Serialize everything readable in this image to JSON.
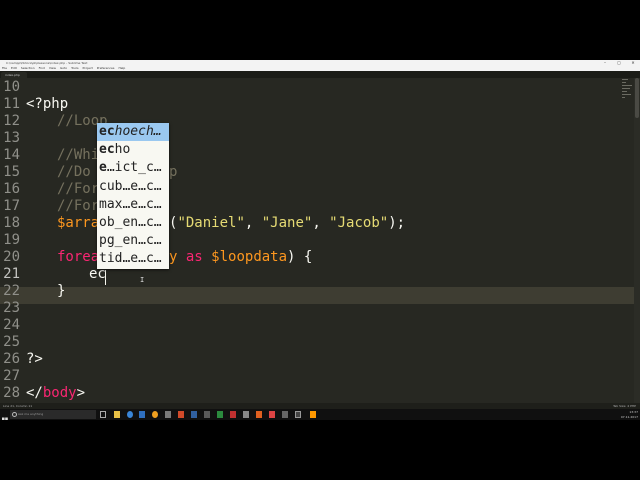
{
  "window": {
    "title": "C:\\xampp\\htdocs\\phplessons\\index.php - Sublime Text",
    "controls": [
      "–",
      "▢",
      "✕"
    ]
  },
  "menu": [
    "File",
    "Edit",
    "Selection",
    "Find",
    "View",
    "Goto",
    "Tools",
    "Project",
    "Preferences",
    "Help"
  ],
  "tab": {
    "label": "index.php"
  },
  "editor": {
    "line_numbers": [
      "10",
      "11",
      "12",
      "13",
      "14",
      "15",
      "16",
      "17",
      "18",
      "19",
      "20",
      "21",
      "22",
      "23",
      "24",
      "25",
      "26",
      "27",
      "28"
    ],
    "lines": {
      "l11": "<?php",
      "l12": "//Loop",
      "l14": "//Whi",
      "l15_a": "//Do",
      "l15_b": "p",
      "l16": "//For",
      "l17": "//For",
      "l18_var": "$arra",
      "l18_open": "(",
      "l18_s1": "\"Daniel\"",
      "l18_comma1": ", ",
      "l18_s2": "\"Jane\"",
      "l18_comma2": ", ",
      "l18_s3": "\"Jacob\"",
      "l18_close": ");",
      "l20_kw": "forea",
      "l20_y": "y",
      "l20_as": "as",
      "l20_var": "$loopdata",
      "l20_end": ") {",
      "l21": "ec",
      "l22": "}",
      "l26": "?>",
      "l28_open": "</",
      "l28_tag": "body",
      "l28_close": ">"
    }
  },
  "autocomplete": {
    "items": [
      {
        "bold": "ec",
        "rest": "hoech…"
      },
      {
        "bold": "ec",
        "rest": "ho"
      },
      {
        "bold": "e",
        "rest": "…ict_c…"
      },
      {
        "bold": "cub…e…c",
        "rest": "…"
      },
      {
        "bold": "max…e…c",
        "rest": "…"
      },
      {
        "bold": "ob_en…c",
        "rest": "…"
      },
      {
        "bold": "pg_en…c",
        "rest": "…"
      },
      {
        "bold": "tid…e…c",
        "rest": "…"
      }
    ]
  },
  "statusbar": {
    "left": "Line 21, Column 11",
    "right": "Tab Size: 4    PHP"
  },
  "taskbar": {
    "search_placeholder": "Ask me anything",
    "time": "13:37",
    "date": "07.11.2017"
  },
  "colors": {
    "editor_bg": "#272822",
    "comment": "#75715e",
    "variable": "#fd971f",
    "string": "#e6db74",
    "keyword": "#f92672",
    "autocomplete_selected": "#9ac8f0"
  }
}
